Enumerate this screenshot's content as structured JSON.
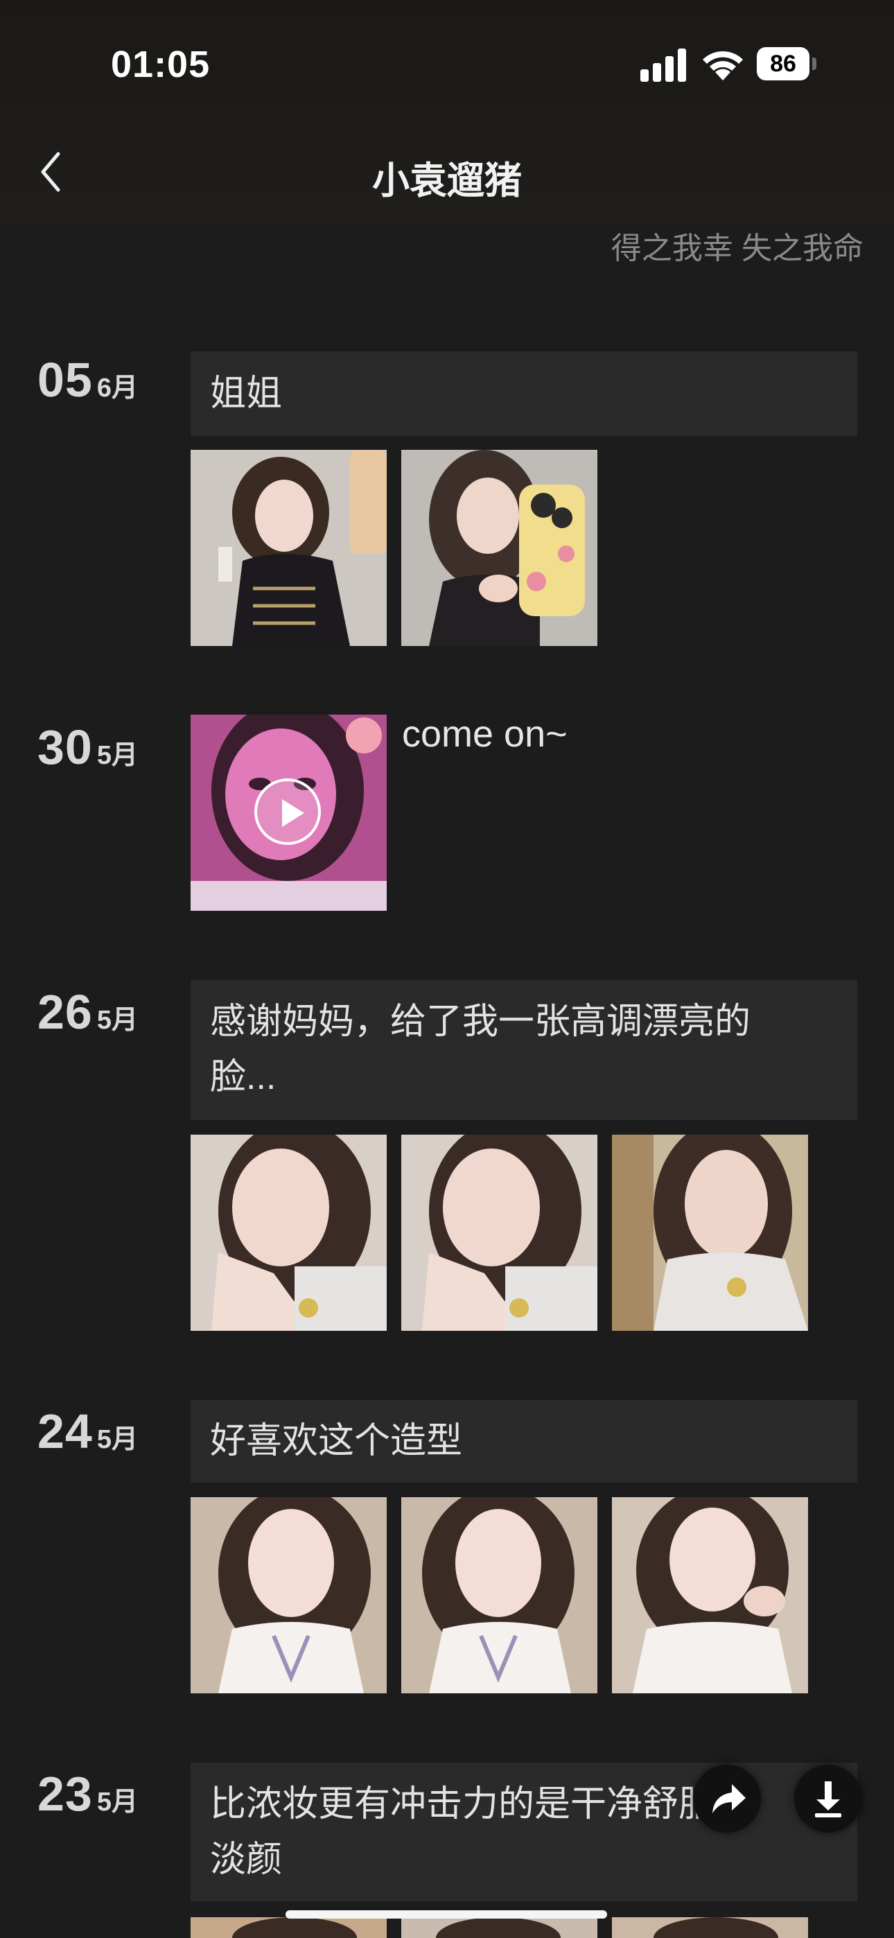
{
  "status_bar": {
    "time": "01:05",
    "battery": "86"
  },
  "nav": {
    "title": "小袁遛猪"
  },
  "profile": {
    "signature": "得之我幸 失之我命"
  },
  "feed": [
    {
      "day": "05",
      "month": "6月",
      "text": "姐姐",
      "media_count": 2
    },
    {
      "day": "30",
      "month": "5月",
      "text": "come on~",
      "media_count": 1,
      "is_video": true
    },
    {
      "day": "26",
      "month": "5月",
      "text": "感谢妈妈，给了我一张高调漂亮的脸...",
      "text_lines": [
        "感谢妈妈，给了我一张高调漂亮的",
        "脸..."
      ],
      "media_count": 3
    },
    {
      "day": "24",
      "month": "5月",
      "text": "好喜欢这个造型",
      "media_count": 3
    },
    {
      "day": "23",
      "month": "5月",
      "text": "比浓妆更有冲击力的是干净舒服的淡颜",
      "text_lines": [
        "比浓妆更有冲击力的是干净舒服的",
        "淡颜"
      ],
      "media_count": 3
    }
  ],
  "icons": {
    "back": "chevron-left-icon",
    "signal": "cellular-signal-icon",
    "wifi": "wifi-icon",
    "battery": "battery-icon",
    "play": "play-icon",
    "share": "share-icon",
    "download": "download-icon"
  },
  "colors": {
    "background": "#1c1c1c",
    "text_box": "#2a2a2a",
    "signature": "#8a8a8a"
  }
}
